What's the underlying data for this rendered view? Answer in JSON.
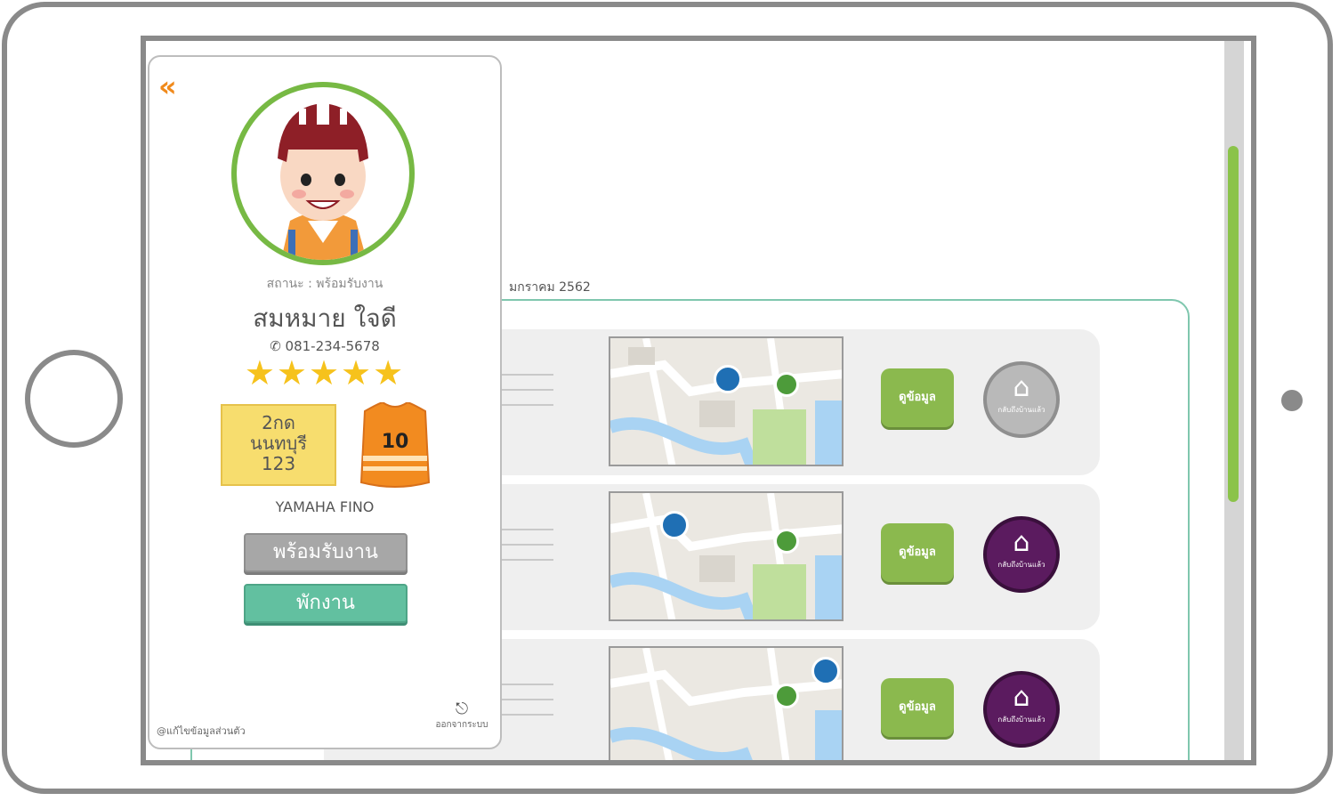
{
  "background": {
    "date_label": "มกราคม 2562",
    "jobs": [
      {
        "info_label": "ดูข้อมูล",
        "home_label": "กลับถึงบ้านแล้ว",
        "home_style": "grey"
      },
      {
        "info_label": "ดูข้อมูล",
        "home_label": "กลับถึงบ้านแล้ว",
        "home_style": "purple"
      },
      {
        "info_label": "ดูข้อมูล",
        "home_label": "กลับถึงบ้านแล้ว",
        "home_style": "purple"
      }
    ]
  },
  "panel": {
    "status": "สถานะ : พร้อมรับงาน",
    "name": "สมหมาย ใจดี",
    "phone": "081-234-5678",
    "rating": 5,
    "stars_text": "★★★★★",
    "plate": {
      "line1": "2กด",
      "line2": "นนทบุรี",
      "line3": "123"
    },
    "vest_number": "10",
    "bike_model": "YAMAHA FINO",
    "buttons": {
      "ready": "พร้อมรับงาน",
      "break": "พักงาน"
    },
    "footer_left": "@แก้ไขข้อมูลส่วนตัว",
    "footer_right": "ออกจากระบบ"
  },
  "colors": {
    "accent_green": "#8bb94e",
    "teal": "#62c0a0",
    "purple": "#5b1b5f",
    "star": "#f6c21c",
    "back_arrow": "#f08a1c"
  }
}
